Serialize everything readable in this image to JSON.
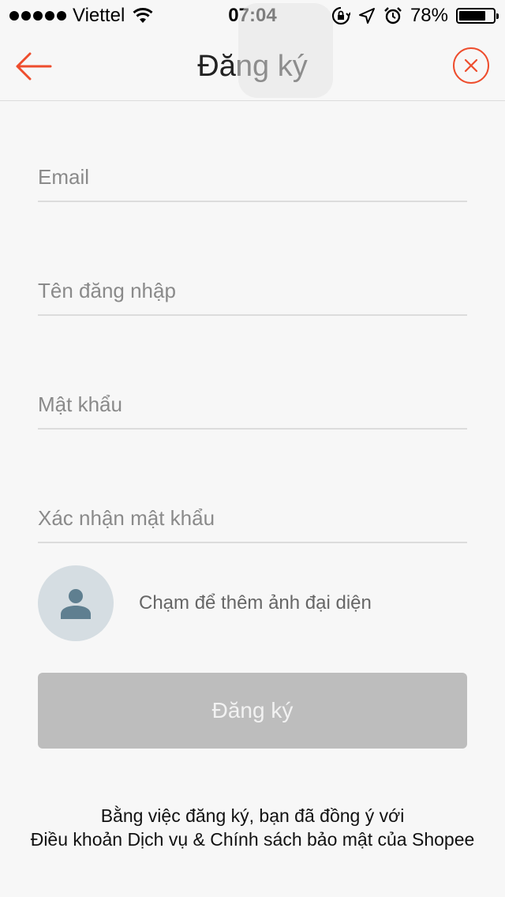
{
  "status_bar": {
    "carrier": "Viettel",
    "time": "07:04",
    "battery_percent": "78%",
    "battery_level": 0.78
  },
  "nav": {
    "title": "Đăng ký",
    "back_icon": "arrow-left-icon",
    "close_icon": "close-circle-icon",
    "accent_color": "#ee4d2d"
  },
  "form": {
    "email_placeholder": "Email",
    "username_placeholder": "Tên đăng nhập",
    "password_placeholder": "Mật khẩu",
    "confirm_placeholder": "Xác nhận mật khẩu",
    "email_value": "",
    "username_value": "",
    "password_value": "",
    "confirm_value": ""
  },
  "avatar": {
    "icon": "person-icon",
    "label": "Chạm để thêm ảnh đại diện"
  },
  "register_button": {
    "label": "Đăng ký",
    "color": "#bdbdbd"
  },
  "terms": {
    "line1": "Bằng việc đăng ký, bạn đã đồng ý với",
    "line2": "Điều khoản Dịch vụ & Chính sách bảo mật của Shopee"
  }
}
